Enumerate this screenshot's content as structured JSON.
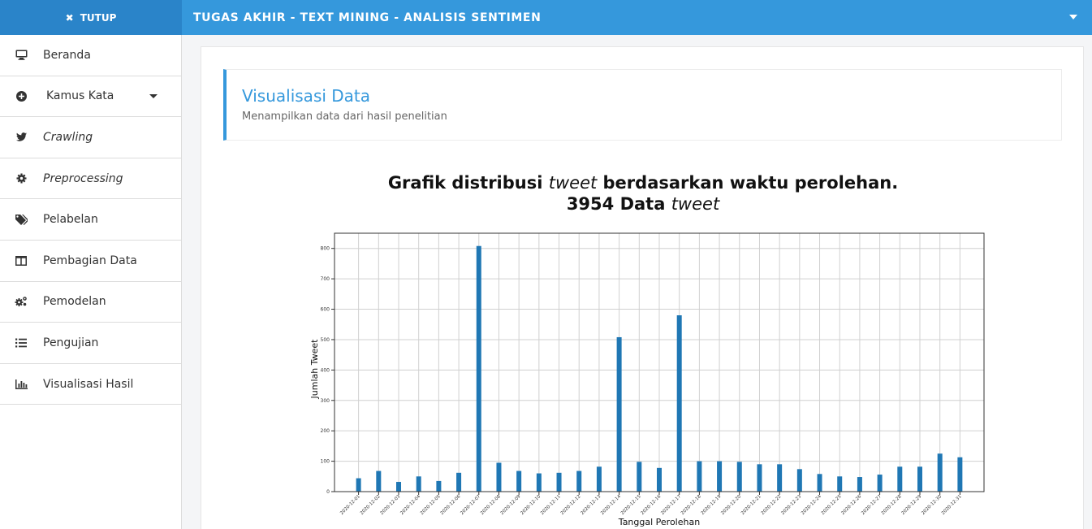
{
  "brand": {
    "close_label": "TUTUP"
  },
  "header": {
    "title": "TUGAS AKHIR - TEXT MINING - ANALISIS SENTIMEN"
  },
  "sidebar": {
    "items": [
      {
        "label": "Beranda",
        "icon": "monitor-icon"
      },
      {
        "label": "Kamus Kata",
        "icon": "plus-circle-icon"
      },
      {
        "label": "Crawling",
        "icon": "twitter-icon"
      },
      {
        "label": "Preprocessing",
        "icon": "gear-icon"
      },
      {
        "label": "Pelabelan",
        "icon": "tags-icon"
      },
      {
        "label": "Pembagian Data",
        "icon": "columns-icon"
      },
      {
        "label": "Pemodelan",
        "icon": "gears-icon"
      },
      {
        "label": "Pengujian",
        "icon": "list-icon"
      },
      {
        "label": "Visualisasi Hasil",
        "icon": "bar-chart-icon"
      }
    ]
  },
  "main": {
    "title": "Visualisasi Data",
    "subtitle": "Menampilkan data dari hasil penelitian",
    "chart_heading": {
      "line1_a": "Grafik distribusi ",
      "line1_b": "tweet",
      "line1_c": " berdasarkan waktu perolehan.",
      "line2_a": "3954 Data ",
      "line2_b": "tweet"
    }
  },
  "chart_data": {
    "type": "bar",
    "xlabel": "Tanggal Perolehan",
    "ylabel": "Jumlah Tweet",
    "ylim": [
      0,
      850
    ],
    "yticks": [
      0,
      100,
      200,
      300,
      400,
      500,
      600,
      700,
      800
    ],
    "grid": true,
    "color": "#1f77b4",
    "categories": [
      "2020-12-01",
      "2020-12-02",
      "2020-12-03",
      "2020-12-04",
      "2020-12-05",
      "2020-12-06",
      "2020-12-07",
      "2020-12-08",
      "2020-12-09",
      "2020-12-10",
      "2020-12-11",
      "2020-12-12",
      "2020-12-13",
      "2020-12-14",
      "2020-12-15",
      "2020-12-16",
      "2020-12-17",
      "2020-12-18",
      "2020-12-19",
      "2020-12-20",
      "2020-12-21",
      "2020-12-22",
      "2020-12-23",
      "2020-12-24",
      "2020-12-25",
      "2020-12-26",
      "2020-12-27",
      "2020-12-28",
      "2020-12-29",
      "2020-12-30",
      "2020-12-31"
    ],
    "values": [
      44,
      68,
      32,
      50,
      35,
      62,
      808,
      95,
      68,
      60,
      62,
      68,
      82,
      508,
      98,
      78,
      580,
      100,
      100,
      98,
      90,
      90,
      74,
      58,
      50,
      48,
      56,
      82,
      82,
      125,
      113
    ]
  }
}
